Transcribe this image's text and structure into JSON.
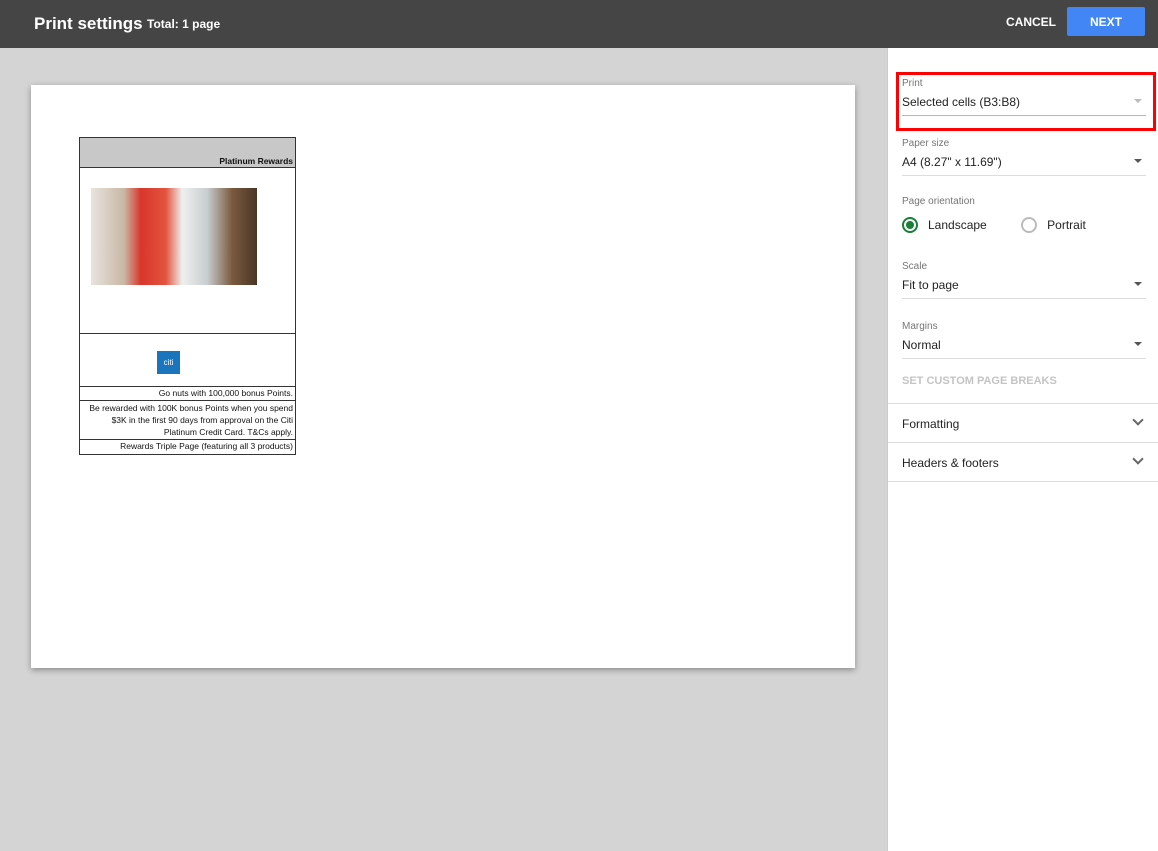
{
  "header": {
    "title": "Print settings",
    "total": "Total: 1 page",
    "cancel": "CANCEL",
    "next": "NEXT"
  },
  "preview": {
    "rows": [
      "Platinum Rewards",
      "Go nuts with 100,000 bonus Points.",
      "Be rewarded with 100K bonus Points when you spend $3K in the first 90 days from approval on the Citi Platinum Credit Card. T&Cs apply.",
      "Rewards Triple Page (featuring all 3 products)"
    ],
    "logo": "citi"
  },
  "settings": {
    "print": {
      "label": "Print",
      "value": "Selected cells (B3:B8)"
    },
    "paper": {
      "label": "Paper size",
      "value": "A4 (8.27\" x 11.69\")"
    },
    "orientation": {
      "label": "Page orientation",
      "options": [
        "Landscape",
        "Portrait"
      ],
      "selected": "Landscape"
    },
    "scale": {
      "label": "Scale",
      "value": "Fit to page"
    },
    "margins": {
      "label": "Margins",
      "value": "Normal"
    },
    "breaks": "SET CUSTOM PAGE BREAKS",
    "formatting": "Formatting",
    "headers": "Headers & footers"
  },
  "colors": {
    "accent": "#4285f4",
    "radio": "#188038",
    "highlight": "#ff0000"
  }
}
